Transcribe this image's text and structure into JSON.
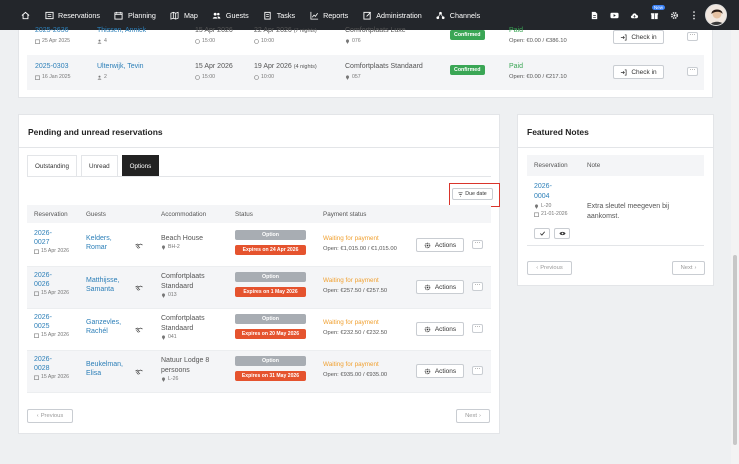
{
  "nav": {
    "items": [
      {
        "label": "",
        "icon": "home-icon"
      },
      {
        "label": "Reservations",
        "icon": "list-icon"
      },
      {
        "label": "Planning",
        "icon": "calendar-icon"
      },
      {
        "label": "Map",
        "icon": "map-icon"
      },
      {
        "label": "Guests",
        "icon": "users-icon"
      },
      {
        "label": "Tasks",
        "icon": "clipboard-icon"
      },
      {
        "label": "Reports",
        "icon": "chart-icon"
      },
      {
        "label": "Administration",
        "icon": "edit-icon"
      },
      {
        "label": "Channels",
        "icon": "network-icon"
      }
    ],
    "new_badge": "New"
  },
  "top_rows": [
    {
      "number": "2025-2636",
      "date": "25 Apr 2025",
      "guest": "Thissen, Annick",
      "guests_count": "4",
      "arrival": "15 Apr 2026",
      "arrival_time": "15:00",
      "departure": "22 Apr 2026",
      "nights": "(7 nights)",
      "departure_time": "10:00",
      "accommodation": "Comfortplaats Luxe",
      "place": "076",
      "status": "Confirmed",
      "payment": "Paid",
      "open": "Open: €0.00 / €386.10",
      "action": "Check in"
    },
    {
      "number": "2025-0303",
      "date": "16 Jan 2025",
      "guest": "Ulterwijk, Tevin",
      "guests_count": "2",
      "arrival": "15 Apr 2026",
      "arrival_time": "15:00",
      "departure": "19 Apr 2026",
      "nights": "(4 nights)",
      "departure_time": "10:00",
      "accommodation": "Comfortplaats Standaard",
      "place": "057",
      "status": "Confirmed",
      "payment": "Paid",
      "open": "Open: €0.00 / €217.10",
      "action": "Check in"
    }
  ],
  "pending": {
    "title": "Pending and unread reservations",
    "tabs": [
      "Outstanding",
      "Unread",
      "Options"
    ],
    "active_tab": "Options",
    "due_date_label": "Due date",
    "headers": [
      "Reservation",
      "Guests",
      "Accommodation",
      "Status",
      "Payment status"
    ],
    "rows": [
      {
        "num1": "2026-",
        "num2": "0027",
        "date": "15 Apr 2026",
        "guest1": "Kelders,",
        "guest2": "Romar",
        "acc1": "Beach House",
        "acc2": "",
        "place": "BH-2",
        "status": "Option",
        "expires": "Expires on 24 Apr 2026",
        "payment": "Waiting for payment",
        "open": "Open: €1,015.00 / €1,015.00",
        "actions": "Actions"
      },
      {
        "num1": "2026-",
        "num2": "0026",
        "date": "15 Apr 2026",
        "guest1": "Matthijsse,",
        "guest2": "Samanta",
        "acc1": "Comfortplaats",
        "acc2": "Standaard",
        "place": "013",
        "status": "Option",
        "expires": "Expires on 1 May 2026",
        "payment": "Waiting for payment",
        "open": "Open: €257.50 / €257.50",
        "actions": "Actions"
      },
      {
        "num1": "2026-",
        "num2": "0025",
        "date": "15 Apr 2026",
        "guest1": "Ganzevles,",
        "guest2": "Rachél",
        "acc1": "Comfortplaats",
        "acc2": "Standaard",
        "place": "041",
        "status": "Option",
        "expires": "Expires on 20 May 2026",
        "payment": "Waiting for payment",
        "open": "Open: €232.50 / €232.50",
        "actions": "Actions"
      },
      {
        "num1": "2026-",
        "num2": "0028",
        "date": "15 Apr 2026",
        "guest1": "Beukelman,",
        "guest2": "Elisa",
        "acc1": "Natuur Lodge 8",
        "acc2": "persoons",
        "place": "L-26",
        "status": "Option",
        "expires": "Expires on 31 May 2026",
        "payment": "Waiting for payment",
        "open": "Open: €935.00 / €935.00",
        "actions": "Actions"
      }
    ],
    "prev": "Previous",
    "next": "Next"
  },
  "featured": {
    "title": "Featured Notes",
    "headers": [
      "Reservation",
      "Note"
    ],
    "note": {
      "num1": "2026-",
      "num2": "0004",
      "place": "L-20",
      "date": "21-01-2026",
      "text1": "Extra sleutel meegeven bij",
      "text2": "aankomst."
    },
    "prev": "Previous",
    "next": "Next"
  }
}
